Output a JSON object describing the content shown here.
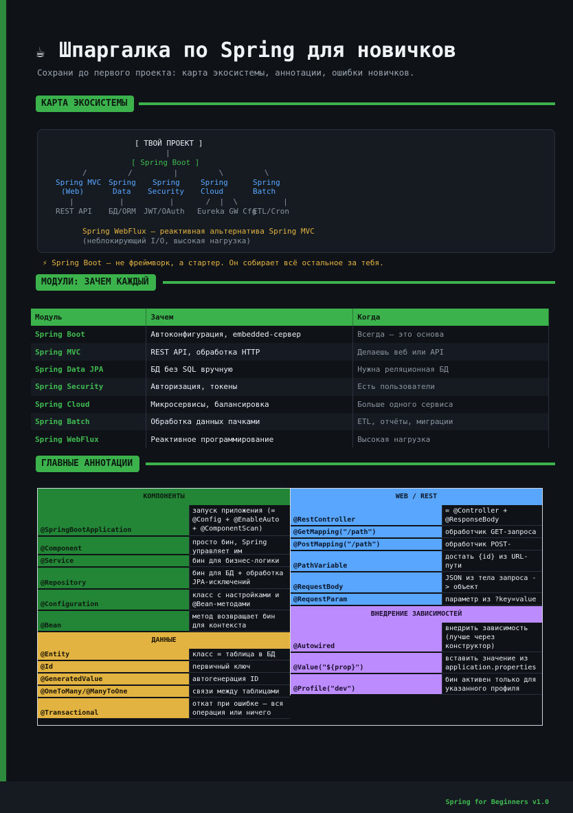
{
  "header": {
    "icon": "coffee-cup-icon",
    "icon_glyph": "☕",
    "title": "Шпаргалка по Spring для новичков",
    "subtitle": "Сохрани до первого проекта: карта экосистемы, аннотации, ошибки новичков."
  },
  "sections": {
    "map": "КАРТА ЭКОСИСТЕМЫ",
    "modules": "МОДУЛИ: ЗАЧЕМ КАЖДЫЙ",
    "annotations": "ГЛАВНЫЕ АННОТАЦИИ"
  },
  "map": {
    "project": "[ ТВОЙ ПРОЕКТ ]",
    "pipe": "|",
    "boot": "[ Spring Boot ]",
    "slashes": "/         /         |         \\         \\",
    "mvc1": "Spring MVC",
    "mvc2": "(Web)",
    "data1": "Spring",
    "data2": "Data",
    "sec1": "Spring",
    "sec2": "Security",
    "cloud1": "Spring",
    "cloud2": "Cloud",
    "batch1": "Spring",
    "batch2": "Batch",
    "pipes2": "|          |          |       /  |  \\          |",
    "use_rest": "REST API",
    "use_orm": "БД/ORM",
    "use_jwt": "JWT/OAuth",
    "use_cloud": "Eureka GW Cfg",
    "use_etl": "ETL/Cron",
    "webflux": "Spring WebFlux — реактивная альтернатива Spring MVC",
    "webflux_note": "(неблокирующий I/O, высокая нагрузка)",
    "tip": "⚡ Spring Boot — не фреймворк, а стартер. Он собирает всё остальное за тебя."
  },
  "modules_table": {
    "headers": [
      "Модуль",
      "Зачем",
      "Когда"
    ],
    "rows": [
      [
        "Spring Boot",
        "Автоконфигурация, embedded-сервер",
        "Всегда — это основа"
      ],
      [
        "Spring MVC",
        "REST API, обработка HTTP",
        "Делаешь веб или API"
      ],
      [
        "Spring Data JPA",
        "БД без SQL вручную",
        "Нужна реляционная БД"
      ],
      [
        "Spring Security",
        "Авторизация, токены",
        "Есть пользователи"
      ],
      [
        "Spring Cloud",
        "Микросервисы, балансировка",
        "Больше одного сервиса"
      ],
      [
        "Spring Batch",
        "Обработка данных пачками",
        "ETL, отчёты, миграции"
      ],
      [
        "Spring WebFlux",
        "Реактивное программирование",
        "Высокая нагрузка"
      ]
    ]
  },
  "annotations": {
    "components": {
      "title": "КОМПОНЕНТЫ",
      "items": [
        {
          "k": "@SpringBootApplication",
          "v": "запуск приложения (= @Config + @EnableAuto + @ComponentScan)"
        },
        {
          "k": "@Component",
          "v": "просто бин, Spring управляет им"
        },
        {
          "k": "@Service",
          "v": "бин для бизнес-логики"
        },
        {
          "k": "@Repository",
          "v": "бин для БД + обработка JPA-исключений"
        },
        {
          "k": "@Configuration",
          "v": "класс с настройками и @Bean-методами"
        },
        {
          "k": "@Bean",
          "v": "метод возвращает бин для контекста"
        }
      ]
    },
    "data": {
      "title": "ДАННЫЕ",
      "items": [
        {
          "k": "@Entity",
          "v": "класс = таблица в БД"
        },
        {
          "k": "@Id",
          "v": "первичный ключ"
        },
        {
          "k": "@GeneratedValue",
          "v": "автогенерация ID"
        },
        {
          "k": "@OneToMany/@ManyToOne",
          "v": "связи между таблицами"
        },
        {
          "k": "@Transactional",
          "v": "откат при ошибке — вся операция или ничего"
        }
      ]
    },
    "web": {
      "title": "WEB / REST",
      "items": [
        {
          "k": "@RestController",
          "v": "= @Controller + @ResponseBody"
        },
        {
          "k": "@GetMapping(\"/path\")",
          "v": "обработчик GET-запроса"
        },
        {
          "k": "@PostMapping(\"/path\")",
          "v": "обработчик POST-запроса"
        },
        {
          "k": "@PathVariable",
          "v": "достать {id} из URL-пути"
        },
        {
          "k": "@RequestBody",
          "v": "JSON из тела запроса -> объект"
        },
        {
          "k": "@RequestParam",
          "v": "параметр из ?key=value"
        }
      ]
    },
    "di": {
      "title": "ВНЕДРЕНИЕ ЗАВИСИМОСТЕЙ",
      "items": [
        {
          "k": "@Autowired",
          "v": "внедрить зависимость (лучше через конструктор)"
        },
        {
          "k": "@Value(\"${prop}\")",
          "v": "вставить значение из application.properties"
        },
        {
          "k": "@Profile(\"dev\")",
          "v": "бин активен только для указанного профиля"
        }
      ]
    }
  },
  "footer": {
    "text": "Spring for Beginners v1.0"
  }
}
